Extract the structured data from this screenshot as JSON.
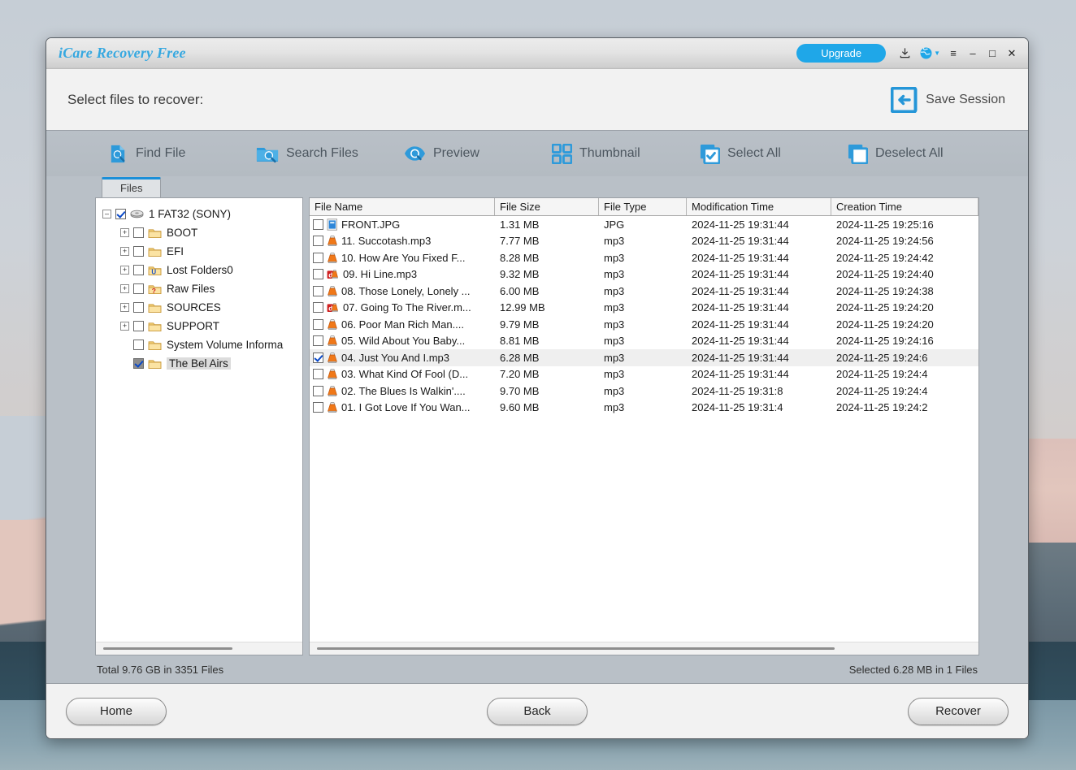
{
  "window": {
    "title": "iCare Recovery Free",
    "upgrade_label": "Upgrade",
    "icons": {
      "download": "download-icon",
      "globe": "globe-icon",
      "caret": "chevron-down-icon",
      "menu": "hamburger-menu-icon",
      "minimize": "minimize-icon",
      "maximize": "maximize-icon",
      "close": "close-icon"
    }
  },
  "header": {
    "page_title": "Select files to recover:",
    "save_session_label": "Save Session"
  },
  "toolbar": {
    "items": [
      {
        "label": "Find File",
        "icon": "find-file-icon"
      },
      {
        "label": "Search Files",
        "icon": "search-files-icon"
      },
      {
        "label": "Preview",
        "icon": "preview-icon"
      },
      {
        "label": "Thumbnail",
        "icon": "thumbnail-icon"
      },
      {
        "label": "Select All",
        "icon": "select-all-icon"
      },
      {
        "label": "Deselect All",
        "icon": "deselect-all-icon"
      }
    ]
  },
  "tabs": [
    {
      "label": "Files",
      "active": true
    }
  ],
  "tree": {
    "root": {
      "label": "1 FAT32 (SONY)",
      "icon": "disk-icon",
      "checked": true,
      "expanded": true
    },
    "children": [
      {
        "label": "BOOT",
        "icon": "folder-icon",
        "checked": false,
        "expandable": true
      },
      {
        "label": "EFI",
        "icon": "folder-icon",
        "checked": false,
        "expandable": true
      },
      {
        "label": "Lost Folders0",
        "icon": "lost-folder-icon",
        "checked": false,
        "expandable": true
      },
      {
        "label": "Raw Files",
        "icon": "raw-folder-icon",
        "checked": false,
        "expandable": true
      },
      {
        "label": "SOURCES",
        "icon": "folder-icon",
        "checked": false,
        "expandable": true
      },
      {
        "label": "SUPPORT",
        "icon": "folder-icon",
        "checked": false,
        "expandable": true
      },
      {
        "label": "System Volume Informa",
        "icon": "folder-icon",
        "checked": false,
        "expandable": false
      },
      {
        "label": "The Bel Airs",
        "icon": "folder-icon",
        "checked": true,
        "expandable": false,
        "selected": true
      }
    ]
  },
  "filelist": {
    "columns": [
      "File Name",
      "File Size",
      "File Type",
      "Modification Time",
      "Creation Time"
    ],
    "rows": [
      {
        "name": "FRONT.JPG",
        "size": "1.31 MB",
        "type": "JPG",
        "modified": "2024-11-25 19:31:44",
        "created": "2024-11-25 19:25:16",
        "checked": false,
        "selected": false,
        "icon": "jpg-file-icon"
      },
      {
        "name": "11. Succotash.mp3",
        "size": "7.77 MB",
        "type": "mp3",
        "modified": "2024-11-25 19:31:44",
        "created": "2024-11-25 19:24:56",
        "checked": false,
        "selected": false,
        "icon": "vlc-file-icon"
      },
      {
        "name": "10. How Are You Fixed F...",
        "size": "8.28 MB",
        "type": "mp3",
        "modified": "2024-11-25 19:31:44",
        "created": "2024-11-25 19:24:42",
        "checked": false,
        "selected": false,
        "icon": "vlc-file-icon"
      },
      {
        "name": "09. Hi Line.mp3",
        "size": "9.32 MB",
        "type": "mp3",
        "modified": "2024-11-25 19:31:44",
        "created": "2024-11-25 19:24:40",
        "checked": false,
        "selected": false,
        "icon": "vlc-alt-file-icon"
      },
      {
        "name": "08. Those Lonely, Lonely ...",
        "size": "6.00 MB",
        "type": "mp3",
        "modified": "2024-11-25 19:31:44",
        "created": "2024-11-25 19:24:38",
        "checked": false,
        "selected": false,
        "icon": "vlc-file-icon"
      },
      {
        "name": "07. Going To The River.m...",
        "size": "12.99 MB",
        "type": "mp3",
        "modified": "2024-11-25 19:31:44",
        "created": "2024-11-25 19:24:20",
        "checked": false,
        "selected": false,
        "icon": "vlc-alt-file-icon"
      },
      {
        "name": "06. Poor Man Rich Man....",
        "size": "9.79 MB",
        "type": "mp3",
        "modified": "2024-11-25 19:31:44",
        "created": "2024-11-25 19:24:20",
        "checked": false,
        "selected": false,
        "icon": "vlc-file-icon"
      },
      {
        "name": "05. Wild About You Baby...",
        "size": "8.81 MB",
        "type": "mp3",
        "modified": "2024-11-25 19:31:44",
        "created": "2024-11-25 19:24:16",
        "checked": false,
        "selected": false,
        "icon": "vlc-file-icon"
      },
      {
        "name": "04. Just You And I.mp3",
        "size": "6.28 MB",
        "type": "mp3",
        "modified": "2024-11-25 19:31:44",
        "created": "2024-11-25 19:24:6",
        "checked": true,
        "selected": true,
        "icon": "vlc-file-icon"
      },
      {
        "name": "03. What Kind Of Fool (D...",
        "size": "7.20 MB",
        "type": "mp3",
        "modified": "2024-11-25 19:31:44",
        "created": "2024-11-25 19:24:4",
        "checked": false,
        "selected": false,
        "icon": "vlc-file-icon"
      },
      {
        "name": "02. The Blues Is Walkin'....",
        "size": "9.70 MB",
        "type": "mp3",
        "modified": "2024-11-25 19:31:8",
        "created": "2024-11-25 19:24:4",
        "checked": false,
        "selected": false,
        "icon": "vlc-file-icon"
      },
      {
        "name": "01. I Got Love If You Wan...",
        "size": "9.60 MB",
        "type": "mp3",
        "modified": "2024-11-25 19:31:4",
        "created": "2024-11-25 19:24:2",
        "checked": false,
        "selected": false,
        "icon": "vlc-file-icon"
      }
    ]
  },
  "status": {
    "left": "Total 9.76 GB in 3351 Files",
    "right": "Selected 6.28 MB in 1 Files"
  },
  "buttons": {
    "home": "Home",
    "back": "Back",
    "recover": "Recover"
  },
  "colors": {
    "accent_blue": "#1fa7e8",
    "title_blue": "#36a8e0",
    "toolbar_gray": "#b9c0c7",
    "tab_active_border": "#1a8fd8",
    "checkbox_check": "#0a49c8"
  }
}
